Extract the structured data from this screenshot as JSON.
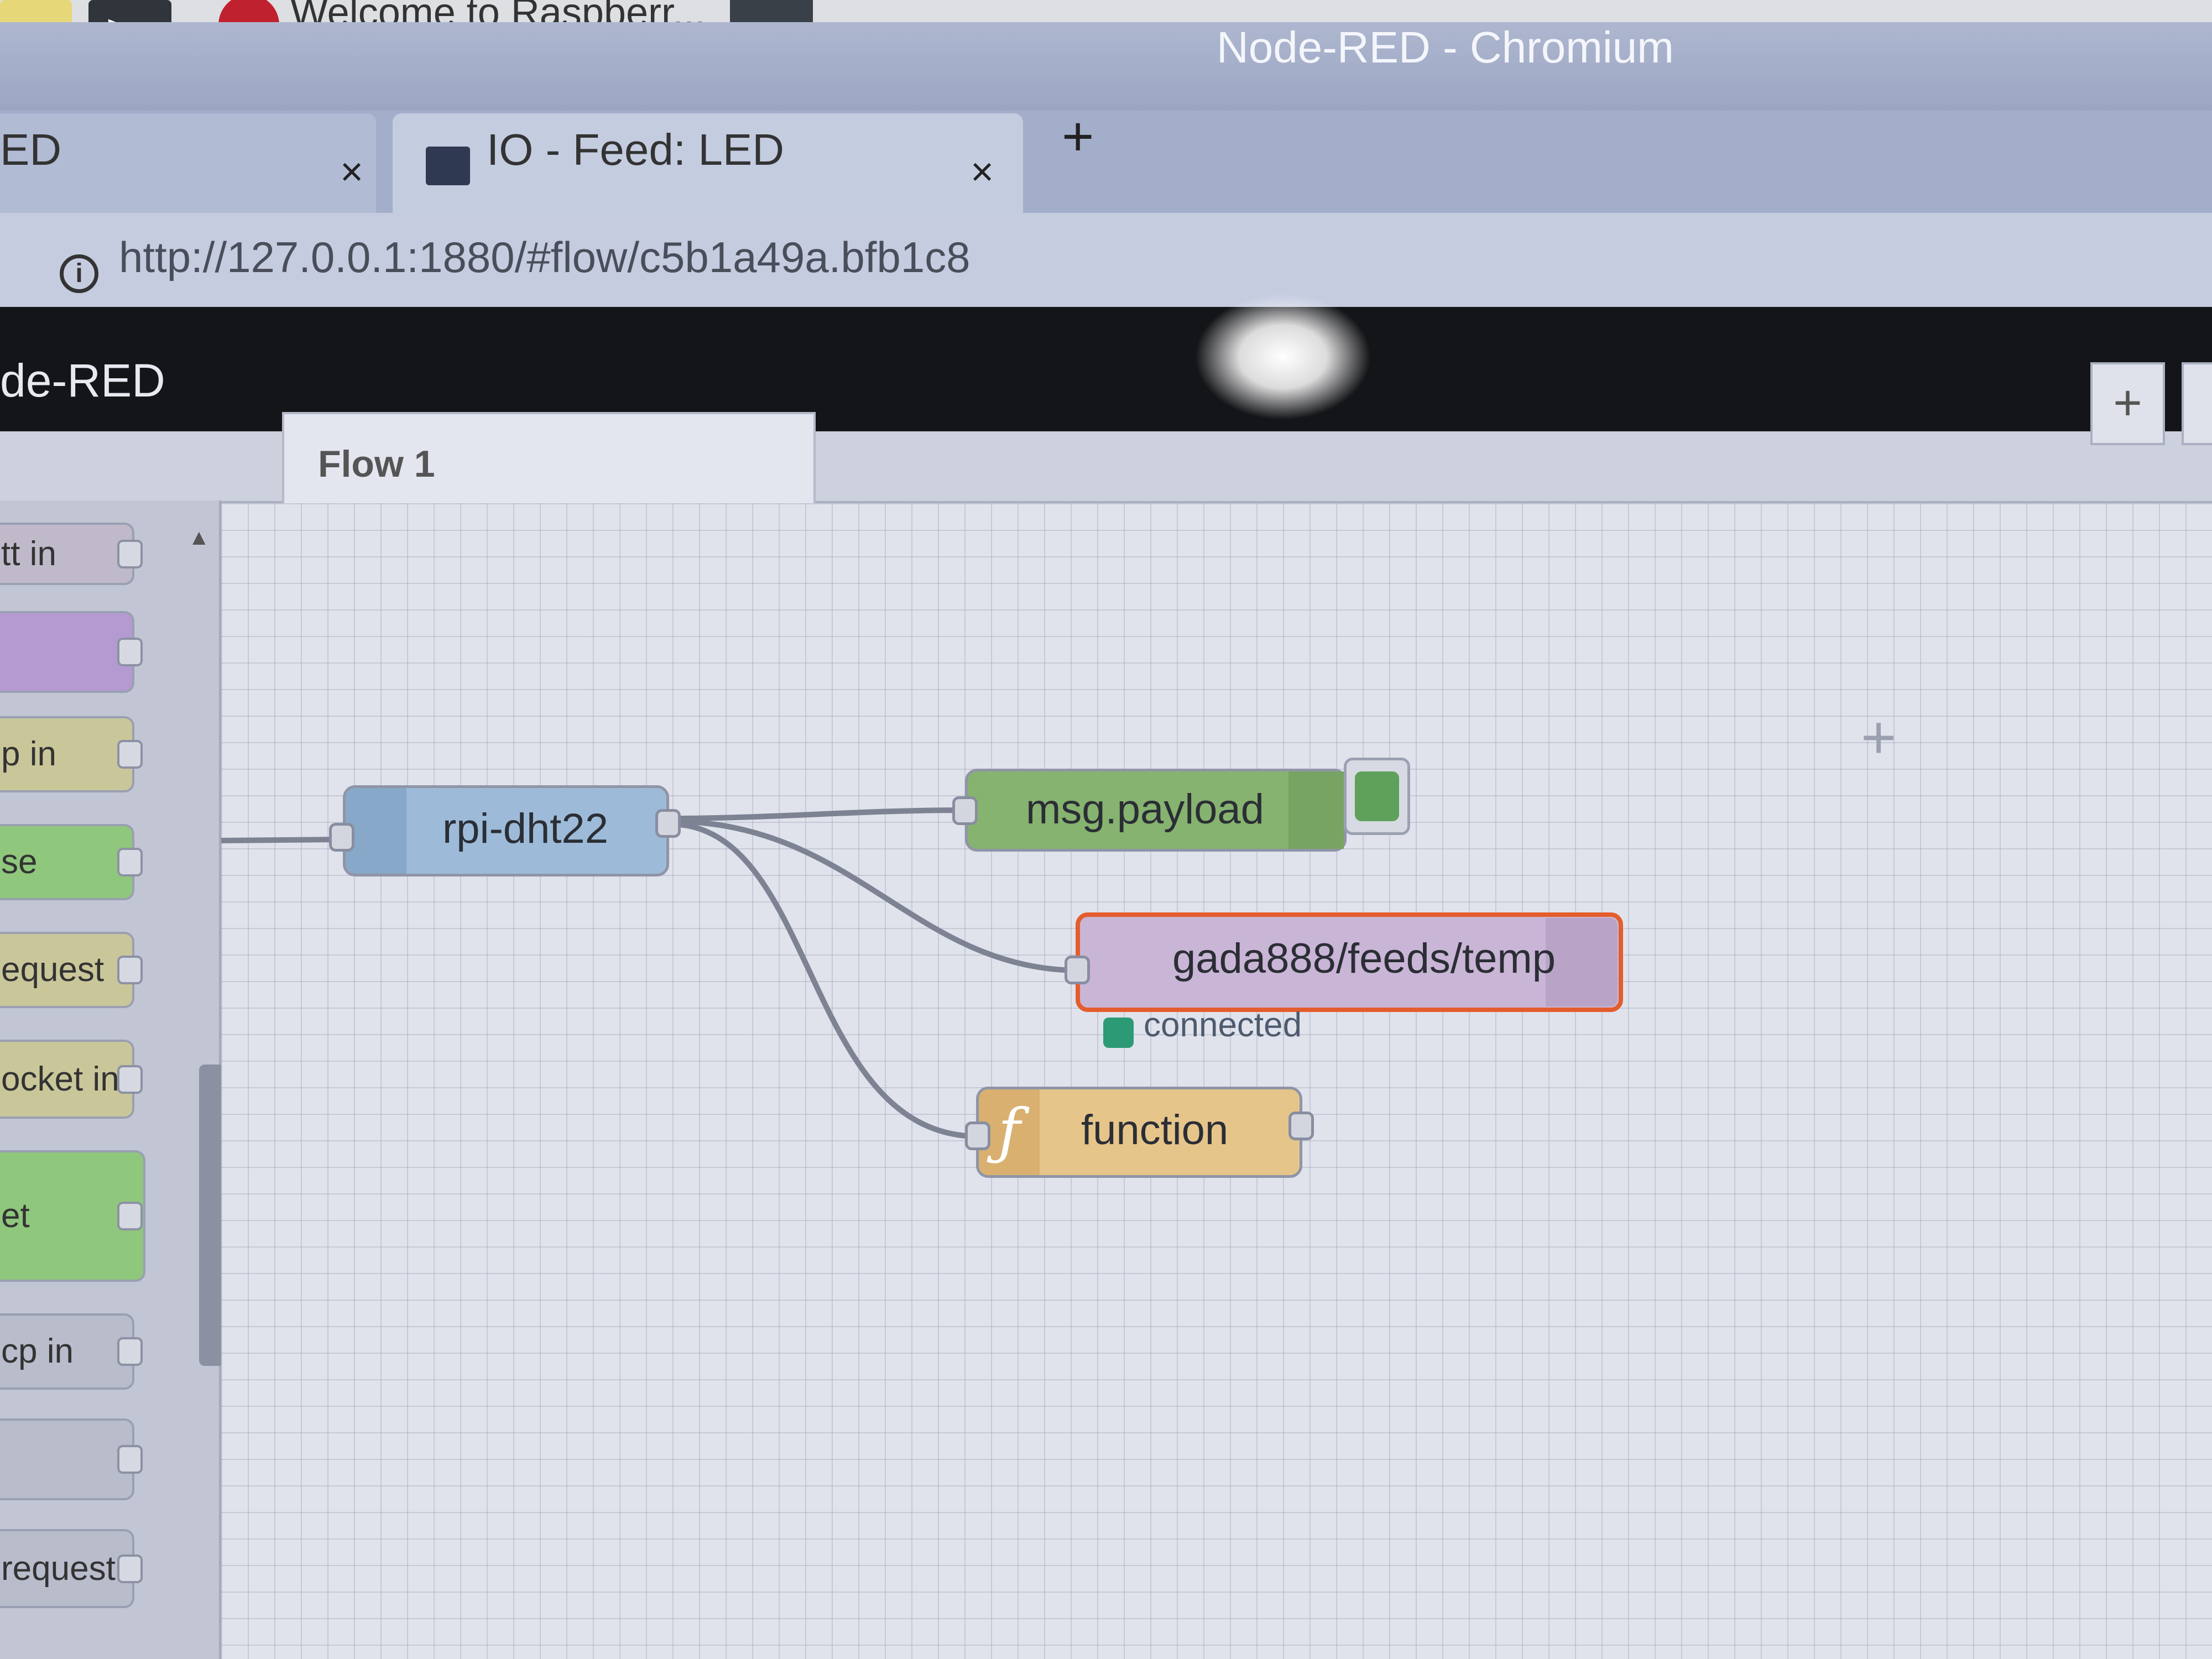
{
  "taskbar": {
    "terminal_icon": "terminal-icon",
    "raspberry_icon": "raspberry-pi-icon",
    "welcome_label": "Welcome to Raspberr..."
  },
  "window": {
    "title": "Node-RED - Chromium"
  },
  "tabs": [
    {
      "label": "ED",
      "close": "×"
    },
    {
      "label": "IO - Feed: LED",
      "close": "×"
    }
  ],
  "new_tab_label": "+",
  "address": {
    "url": "http://127.0.0.1:1880/#flow/c5b1a49a.bfb1c8",
    "info_icon": "i"
  },
  "header": {
    "title": "de-RED"
  },
  "workspace": {
    "flow_tab": "Flow 1",
    "add_flow": "+"
  },
  "palette": {
    "items": [
      {
        "label": "tt in",
        "color": "#bfb9c9"
      },
      {
        "label": "",
        "color": "#b49ad0"
      },
      {
        "label": "p in",
        "color": "#c9c79a"
      },
      {
        "label": "se",
        "color": "#8fc77d"
      },
      {
        "label": "equest",
        "color": "#c9c79a"
      },
      {
        "label": "ocket in",
        "color": "#c9c79a"
      },
      {
        "label": "et",
        "color": "#8fc77d"
      },
      {
        "label": "cp in",
        "color": "#b8bccb"
      },
      {
        "label": "",
        "color": "#b8bccb"
      },
      {
        "label": "request",
        "color": "#b8bccb"
      }
    ]
  },
  "flow": {
    "nodes": {
      "dht": {
        "label": "rpi-dht22"
      },
      "debug": {
        "label": "msg.payload"
      },
      "mqtt": {
        "label": "gada888/feeds/temp",
        "status": "connected"
      },
      "function": {
        "label": "function",
        "icon": "ƒ"
      }
    }
  },
  "colors": {
    "dht_node": "#9dbbd8",
    "debug_node": "#86b370",
    "mqtt_node": "#c9b5d6",
    "mqtt_selected_border": "#e45d2d",
    "function_node": "#e6c58b",
    "status_connected": "#2c9b75"
  }
}
